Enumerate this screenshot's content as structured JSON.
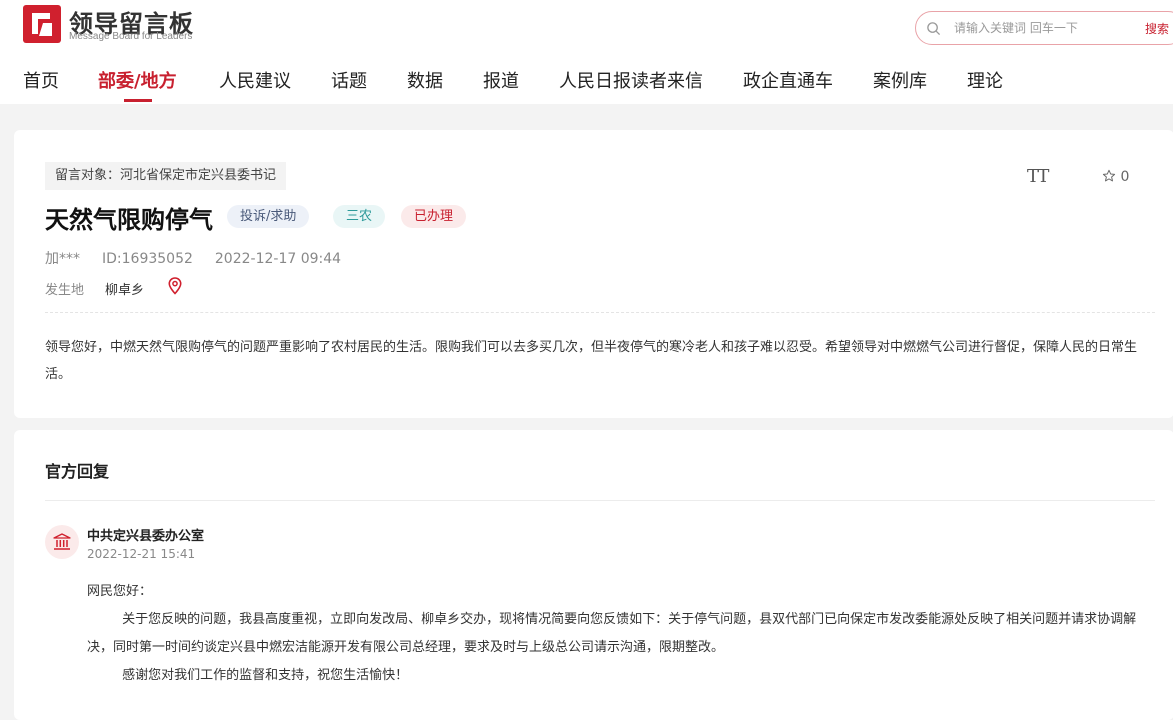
{
  "header": {
    "logo_cn": "领导留言板",
    "logo_en": "Message Board for Leaders",
    "search_placeholder": "请输入关键词 回车一下",
    "search_button": "搜索"
  },
  "nav": {
    "items": [
      "首页",
      "部委/地方",
      "人民建议",
      "话题",
      "数据",
      "报道",
      "人民日报读者来信",
      "政企直通车",
      "案例库",
      "理论"
    ],
    "active": "部委/地方"
  },
  "message": {
    "target": "留言对象：河北省保定市定兴县委书记",
    "title": "天然气限购停气",
    "badges": {
      "type": "投诉/求助",
      "category": "三农",
      "status": "已办理"
    },
    "author": "加***",
    "id": "ID:16935052",
    "datetime": "2022-12-17 09:44",
    "place_label": "发生地",
    "place": "柳卓乡",
    "favorite_count": "0",
    "font_tool": "TT",
    "body": "领导您好，中燃天然气限购停气的问题严重影响了农村居民的生活。限购我们可以去多买几次，但半夜停气的寒冷老人和孩子难以忍受。希望领导对中燃燃气公司进行督促，保障人民的日常生活。"
  },
  "reply": {
    "section_title": "官方回复",
    "org": "中共定兴县委办公室",
    "datetime": "2022-12-21 15:41",
    "greeting": "网民您好：",
    "paragraph1": "关于您反映的问题，我县高度重视，立即向发改局、柳卓乡交办，现将情况简要向您反馈如下：关于停气问题，县双代部门已向保定市发改委能源处反映了相关问题并请求协调解决，同时第一时间约谈定兴县中燃宏洁能源开发有限公司总经理，要求及时与上级总公司请示沟通，限期整改。",
    "paragraph2": "感谢您对我们工作的监督和支持，祝您生活愉快！"
  },
  "colors": {
    "accent": "#c8202f"
  }
}
